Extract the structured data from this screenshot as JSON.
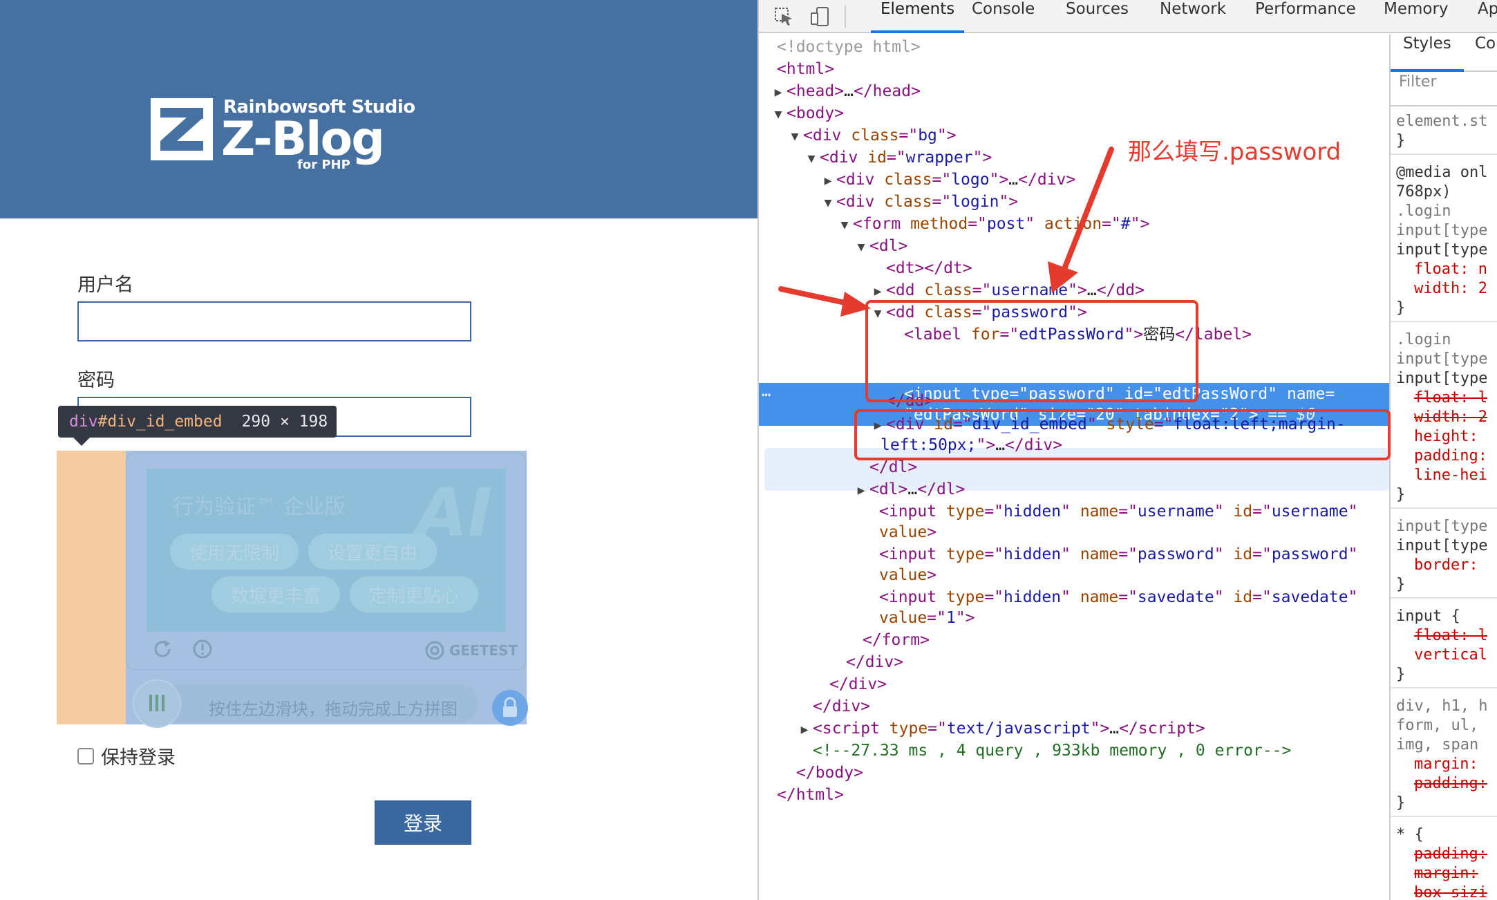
{
  "login_page": {
    "logo": {
      "studio": "Rainbowsoft Studio",
      "name": "Z-Blog",
      "sub": "for PHP"
    },
    "username_label": "用户名",
    "password_label": "密码",
    "inspect_tooltip": {
      "tag": "div",
      "selector": "#div_id_embed",
      "size": "290 × 198"
    },
    "captcha": {
      "title": "行为验证™ 企业版",
      "watermark": "AI",
      "chips": [
        "使用无限制",
        "设置更自由",
        "数据更丰富",
        "定制更贴心"
      ],
      "brand": "GEETEST",
      "slider_hint": "按住左边滑块，拖动完成上方拼图"
    },
    "remember_label": "保持登录",
    "login_button": "登录"
  },
  "devtools": {
    "tabs": [
      "Elements",
      "Console",
      "Sources",
      "Network",
      "Performance",
      "Memory",
      "Ap"
    ],
    "active_tab": "Elements",
    "styles_tabs": [
      "Styles",
      "Co"
    ],
    "filter_placeholder": "Filter",
    "annotation": "那么填写.password",
    "dom": {
      "doctype": "<!doctype html>",
      "html_open": "<html>",
      "head_tag": "head",
      "body_open": "body",
      "bg_class": "bg",
      "wrapper_id": "wrapper",
      "logo_class": "logo",
      "login_class": "login",
      "form_method": "post",
      "form_action": "#",
      "username_class": "username",
      "password_class": "password",
      "label_for": "edtPassWord",
      "label_text": "密码",
      "input_type": "password",
      "input_id": "edtPassWord",
      "input_name": "edtPassWord",
      "input_size": "20",
      "input_tabindex": "2",
      "dollar0": "== $0",
      "embed_id": "div_id_embed",
      "embed_style_a": "float:left;margin-",
      "embed_style_b": "left:50px;",
      "hidden_inputs": [
        {
          "name": "username",
          "id": "username",
          "value": ""
        },
        {
          "name": "password",
          "id": "password",
          "value": ""
        },
        {
          "name": "savedate",
          "id": "savedate",
          "value": "1"
        }
      ],
      "script_type": "text/javascript",
      "comment": "<!--27.33 ms , 4 query , 933kb memory , 0 error-->"
    },
    "styles_lines": [
      "element.st",
      "}",
      "@media onl",
      "768px)",
      ".login",
      "input[type",
      "input[type",
      "float: n",
      "width: 2",
      "}",
      ".login",
      "input[type",
      "input[type",
      "float: l",
      "width: 2",
      "height:",
      "padding:",
      "line-hei",
      "}",
      "input[type",
      "input[type",
      "border:",
      "}",
      "input {",
      "float: l",
      "vertical",
      "}",
      "div, h1, h",
      "form, ul,",
      "img, span",
      "margin:",
      "padding:",
      "}",
      "* {",
      "padding:",
      "margin:",
      "box-sizi"
    ]
  },
  "colors": {
    "banner": "#4670a0",
    "accent_blue": "#1a73e8",
    "selection_row": "#4590e8",
    "annotation_red": "#e53b2e",
    "margin_highlight": "#f3cba0",
    "content_highlight": "#a5c0e0"
  }
}
